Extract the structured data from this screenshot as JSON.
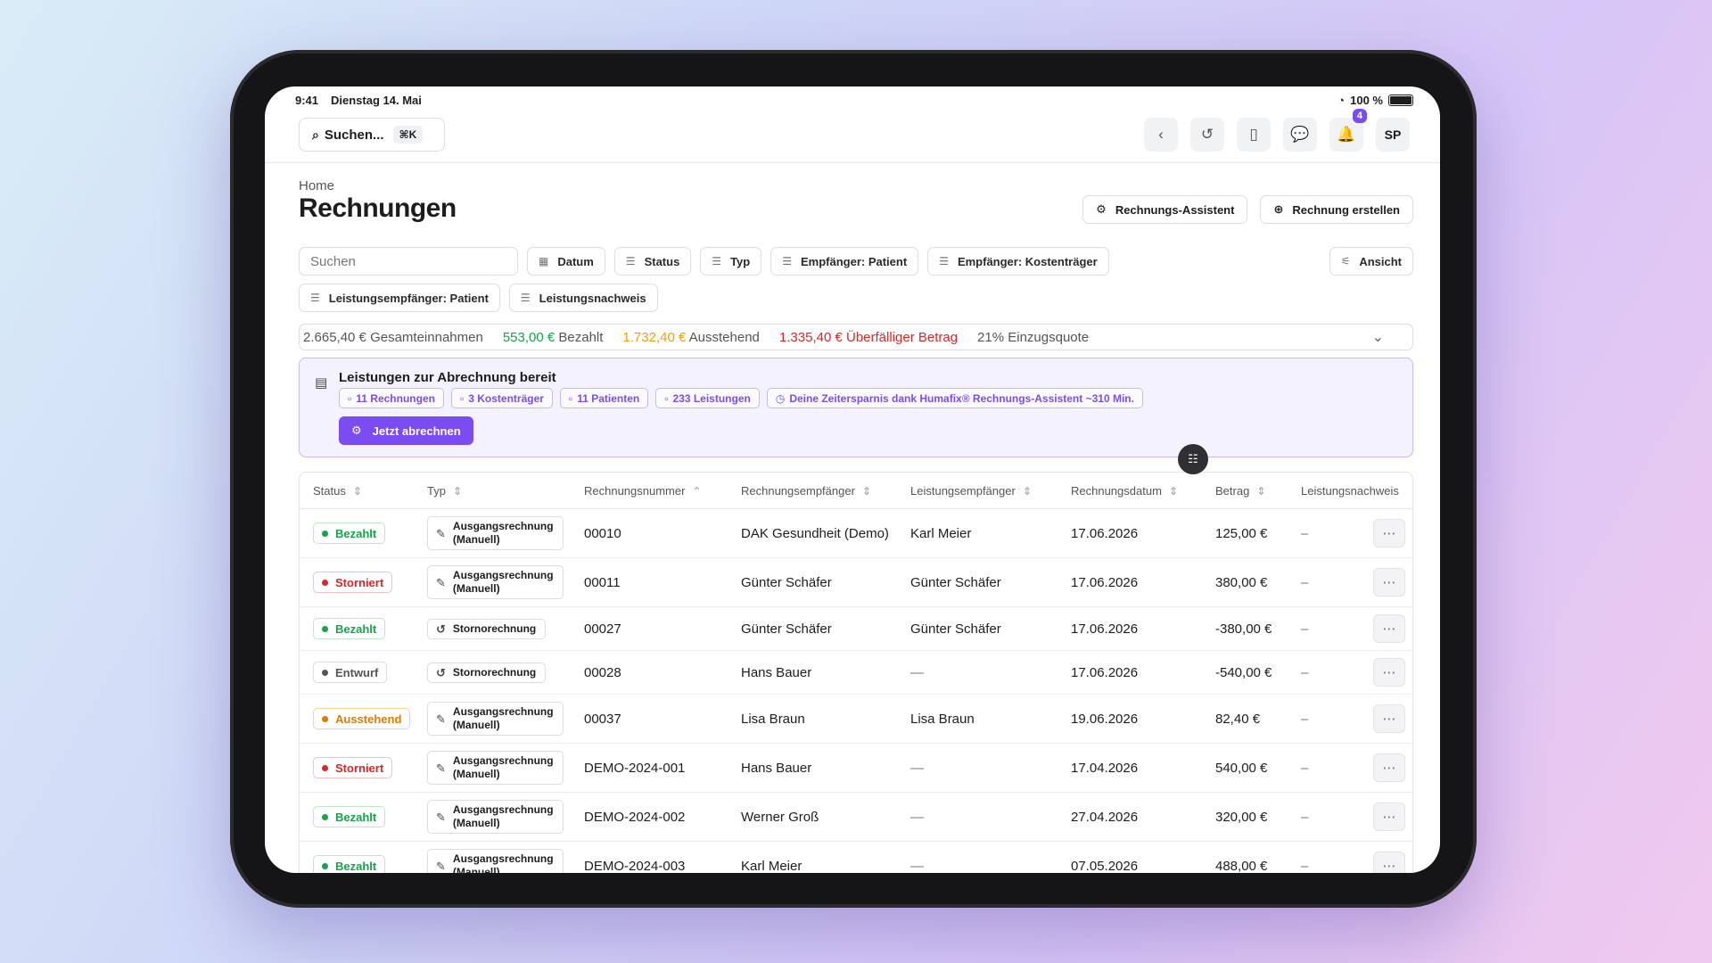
{
  "statusbar": {
    "time": "9:41",
    "date": "Dienstag 14. Mai",
    "battery": "100 %"
  },
  "topbar": {
    "search_label": "Suchen...",
    "shortcut": "⌘K",
    "notifications_count": "4",
    "avatar": "SP"
  },
  "page": {
    "breadcrumb": "Home",
    "title": "Rechnungen",
    "assistant_button": "Rechnungs-Assistent",
    "create_button": "Rechnung erstellen"
  },
  "filters": {
    "search_placeholder": "Suchen",
    "chips": [
      "Datum",
      "Status",
      "Typ",
      "Empfänger: Patient",
      "Empfänger: Kostenträger",
      "Leistungsempfänger: Patient",
      "Leistungsnachweis"
    ],
    "view": "Ansicht"
  },
  "summary": {
    "total": "2.665,40 € Gesamteinnahmen",
    "paid_amount": "553,00 €",
    "paid_label": "Bezahlt",
    "pending_amount": "1.732,40 €",
    "pending_label": "Ausstehend",
    "overdue_amount": "1.335,40 €",
    "overdue_label": "Überfälliger Betrag",
    "quota": "21% Einzugsquote"
  },
  "ready": {
    "title": "Leistungen zur Abrechnung bereit",
    "tags": [
      "11 Rechnungen",
      "3 Kostenträger",
      "11 Patienten",
      "233 Leistungen",
      "Deine Zeitersparnis dank Humafix® Rechnungs-Assistent ~310 Min."
    ],
    "button": "Jetzt abrechnen"
  },
  "table": {
    "headers": [
      "Status",
      "Typ",
      "Rechnungsnummer",
      "Rechnungsempfänger",
      "Leistungsempfänger",
      "Rechnungsdatum",
      "Betrag",
      "Leistungsnachweis"
    ],
    "rows": [
      {
        "status": "Bezahlt",
        "typ1": "Ausgangsrechnung",
        "typ2": "(Manuell)",
        "nr": "00010",
        "re": "DAK Gesundheit (Demo)",
        "le": "Karl Meier",
        "dt": "17.06.2026",
        "bt": "125,00 €",
        "ln": "–"
      },
      {
        "status": "Storniert",
        "typ1": "Ausgangsrechnung",
        "typ2": "(Manuell)",
        "nr": "00011",
        "re": "Günter Schäfer",
        "le": "Günter Schäfer",
        "dt": "17.06.2026",
        "bt": "380,00 €",
        "ln": "–"
      },
      {
        "status": "Bezahlt",
        "typ1": "Stornorechnung",
        "typ2": "",
        "nr": "00027",
        "re": "Günter Schäfer",
        "le": "Günter Schäfer",
        "dt": "17.06.2026",
        "bt": "-380,00 €",
        "ln": "–"
      },
      {
        "status": "Entwurf",
        "typ1": "Stornorechnung",
        "typ2": "",
        "nr": "00028",
        "re": "Hans Bauer",
        "le": "—",
        "dt": "17.06.2026",
        "bt": "-540,00 €",
        "ln": "–"
      },
      {
        "status": "Ausstehend",
        "typ1": "Ausgangsrechnung",
        "typ2": "(Manuell)",
        "nr": "00037",
        "re": "Lisa Braun",
        "le": "Lisa Braun",
        "dt": "19.06.2026",
        "bt": "82,40 €",
        "ln": "–"
      },
      {
        "status": "Storniert",
        "typ1": "Ausgangsrechnung",
        "typ2": "(Manuell)",
        "nr": "DEMO-2024-001",
        "re": "Hans Bauer",
        "le": "—",
        "dt": "17.04.2026",
        "bt": "540,00 €",
        "ln": "–"
      },
      {
        "status": "Bezahlt",
        "typ1": "Ausgangsrechnung",
        "typ2": "(Manuell)",
        "nr": "DEMO-2024-002",
        "re": "Werner Groß",
        "le": "—",
        "dt": "27.04.2026",
        "bt": "320,00 €",
        "ln": "–"
      },
      {
        "status": "Bezahlt",
        "typ1": "Ausgangsrechnung",
        "typ2": "(Manuell)",
        "nr": "DEMO-2024-003",
        "re": "Karl Meier",
        "le": "—",
        "dt": "07.05.2026",
        "bt": "488,00 €",
        "ln": "–"
      }
    ]
  },
  "colors": {
    "accent": "#7b4cf2",
    "paid": "#16a34a",
    "pending": "#f59e0b",
    "overdue": "#dc2626"
  }
}
